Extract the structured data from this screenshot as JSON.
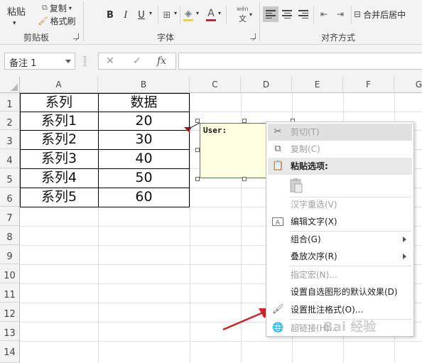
{
  "ribbon": {
    "paste_label": "粘贴",
    "copy_label": "复制",
    "format_painter_label": "格式刷",
    "clipboard_group": "剪贴板",
    "font_group": "字体",
    "align_group": "对齐方式",
    "bold": "B",
    "italic": "I",
    "underline": "U",
    "font_color": "A",
    "wen": "wén",
    "wen_char": "文",
    "merge_center_label": "合并后居中"
  },
  "formula_bar": {
    "name_box": "备注 1",
    "fx": "fx",
    "cancel": "✕",
    "enter": "✓",
    "value": ""
  },
  "grid": {
    "columns": [
      "A",
      "B",
      "C",
      "D",
      "E",
      "F",
      "G"
    ],
    "rows": [
      "1",
      "2",
      "3",
      "4",
      "5",
      "6",
      "7",
      "8",
      "9",
      "10",
      "11",
      "12",
      "13",
      "14"
    ],
    "table": {
      "header": [
        "系列",
        "数据"
      ],
      "rows": [
        [
          "系列1",
          "20"
        ],
        [
          "系列2",
          "30"
        ],
        [
          "系列3",
          "40"
        ],
        [
          "系列4",
          "50"
        ],
        [
          "系列5",
          "60"
        ]
      ]
    }
  },
  "comment": {
    "text": "User:"
  },
  "context_menu": {
    "items": [
      {
        "label": "剪切(T)",
        "icon": "scissors-icon",
        "disabled": true
      },
      {
        "label": "复制(C)",
        "icon": "copy-icon",
        "disabled": true
      },
      {
        "label": "粘贴选项:",
        "icon": "clipboard-icon",
        "header": true
      },
      {
        "label": "汉字重选(V)",
        "disabled": true
      },
      {
        "label": "编辑文字(X)",
        "icon": "edit-text-icon"
      },
      {
        "label": "组合(G)",
        "submenu": true
      },
      {
        "label": "叠放次序(R)",
        "submenu": true
      },
      {
        "label": "指定宏(N)...",
        "disabled": true
      },
      {
        "label": "设置自选图形的默认效果(D)"
      },
      {
        "label": "设置批注格式(O)...",
        "icon": "format-comment-icon"
      },
      {
        "label": "超链接(H)...",
        "icon": "hyperlink-icon",
        "disabled": true
      }
    ]
  },
  "watermark": "Bai 经验",
  "colors": {
    "accent_red": "#d42020",
    "comment_bg": "#ffffe1"
  }
}
